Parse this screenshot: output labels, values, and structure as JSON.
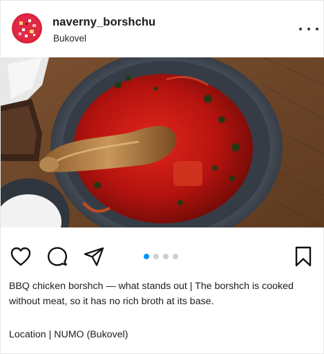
{
  "post": {
    "username": "naverny_borshchu",
    "location": "Bukovel",
    "more_icon": "more-horizontal-icon",
    "carousel": {
      "count": 4,
      "active_index": 0
    },
    "caption": "BBQ chicken borshch — what stands out | The borshch is cooked without meat, so it has no rich broth at its base.",
    "location_line": "Location | NUMO (Bukovel)"
  },
  "icons": {
    "like": "heart-icon",
    "comment": "comment-icon",
    "share": "send-icon",
    "save": "bookmark-icon"
  },
  "colors": {
    "carousel_active": "#0095f6",
    "carousel_inactive": "#cfcfcf",
    "avatar_red": "#d8213a"
  }
}
